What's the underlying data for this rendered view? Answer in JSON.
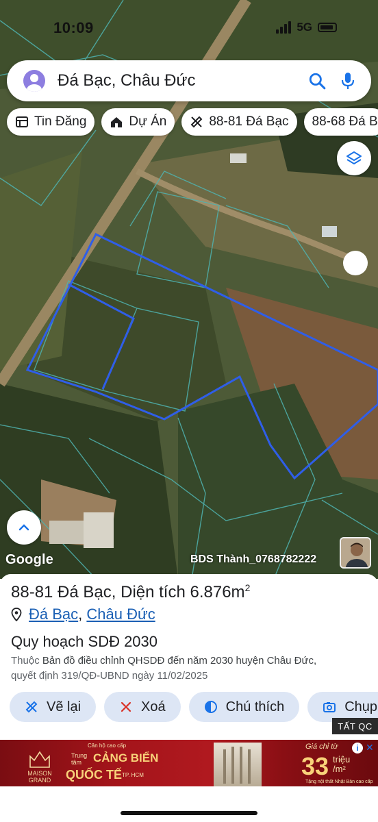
{
  "status_bar": {
    "time": "10:09",
    "network": "5G"
  },
  "search": {
    "query": "Đá Bạc, Châu Đức"
  },
  "chips": [
    {
      "label": "Tin Đăng",
      "icon": "newspaper-icon"
    },
    {
      "label": "Dự Án",
      "icon": "house-icon"
    },
    {
      "label": "88-81 Đá Bạc",
      "icon": "ruler-icon"
    },
    {
      "label": "88-68 Đá B",
      "icon": ""
    }
  ],
  "map": {
    "attribution": "Google",
    "owner_label": "BDS Thành_0768782222",
    "parcel_outline_color": "#2f5ee8"
  },
  "parcel": {
    "name": "88-81 Đá Bạc",
    "area_prefix": "Diện tích",
    "area_value": "6.876m",
    "area_sup": "2",
    "location_1": "Đá Bạc",
    "location_2": "Châu Đức",
    "plan_title": "Quy hoạch SDĐ 2030",
    "desc_prefix": "Thuộc",
    "desc_link": "Bản đồ điều chỉnh QHSDĐ đến năm 2030 huyện Châu Đức,",
    "desc_line2": "quyết định 319/QĐ-UBND ngày 11/02/2025"
  },
  "actions": [
    {
      "label": "Vẽ lại",
      "icon": "redraw-icon"
    },
    {
      "label": "Xoá",
      "icon": "x-icon"
    },
    {
      "label": "Chú thích",
      "icon": "contrast-icon"
    },
    {
      "label": "Chụp",
      "icon": "camera-icon"
    }
  ],
  "ad": {
    "close_label": "TẤT QC",
    "logo": "MAISON GRAND",
    "small": "Căn hộ cao cấp",
    "trung": "Trung tâm",
    "headline_1": "CẢNG BIỂN",
    "headline_2": "QUỐC TẾ",
    "tp": "TP. HCM",
    "price_label": "Giá chỉ từ",
    "price": "33",
    "price_unit": "triệu /m²",
    "footnote": "Tặng nội thất Nhật Bản cao cấp"
  }
}
